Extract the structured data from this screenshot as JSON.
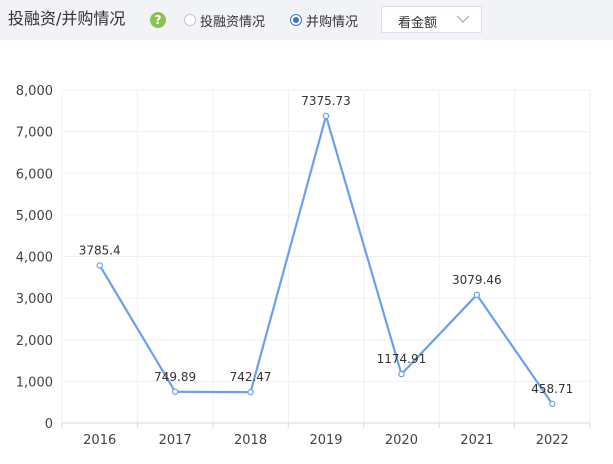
{
  "header": {
    "title": "投融资/并购情况",
    "help_icon": "question-mark-icon",
    "radios": [
      {
        "label": "投融资情况",
        "checked": false
      },
      {
        "label": "并购情况",
        "checked": true
      }
    ],
    "select_value": "看金额"
  },
  "colors": {
    "line": "#6b9ff0",
    "accent": "#3d73d7",
    "help": "#8cc152",
    "header_bg": "#f1f3f6"
  },
  "chart_data": {
    "type": "line",
    "categories": [
      "2016",
      "2017",
      "2018",
      "2019",
      "2020",
      "2021",
      "2022"
    ],
    "series": [
      {
        "values": [
          3785.4,
          749.89,
          742.47,
          7375.73,
          1174.91,
          3079.46,
          458.71
        ]
      }
    ],
    "data_labels": [
      "3785.4",
      "749.89",
      "742.47",
      "7375.73",
      "1174.91",
      "3079.46",
      "458.71"
    ],
    "yticks": [
      "0",
      "1,000",
      "2,000",
      "3,000",
      "4,000",
      "5,000",
      "6,000",
      "7,000",
      "8,000"
    ],
    "ylim": [
      0,
      8000
    ],
    "grid": true,
    "title": "",
    "xlabel": "",
    "ylabel": ""
  }
}
